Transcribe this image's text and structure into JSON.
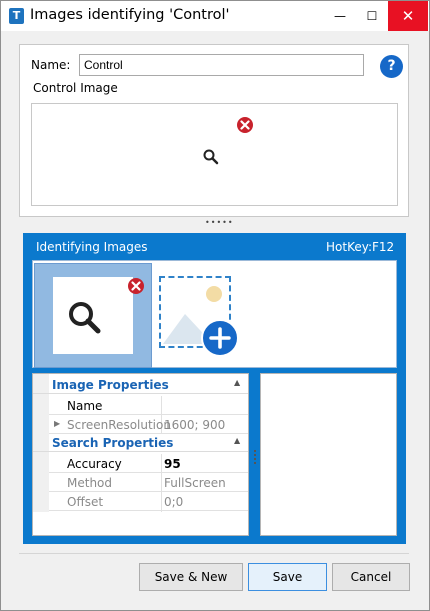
{
  "window": {
    "title": "Images identifying 'Control'",
    "icon_letter": "T",
    "minimize_glyph": "—",
    "maximize_glyph": "☐",
    "close_glyph": "✕"
  },
  "form": {
    "name_label": "Name:",
    "name_value": "Control",
    "help_glyph": "?",
    "control_image_label": "Control Image"
  },
  "identifying": {
    "title": "Identifying Images",
    "hotkey": "HotKey:F12"
  },
  "properties": {
    "categories": [
      {
        "label": "Image Properties",
        "rows": [
          {
            "name": "Name",
            "value": ""
          },
          {
            "name": "ScreenResolution",
            "value": "1600; 900"
          }
        ]
      },
      {
        "label": "Search Properties",
        "rows": [
          {
            "name": "Accuracy",
            "value": "95"
          },
          {
            "name": "Method",
            "value": "FullScreen"
          },
          {
            "name": "Offset",
            "value": "0;0"
          }
        ]
      }
    ]
  },
  "buttons": {
    "save_new": "Save & New",
    "save": "Save",
    "cancel": "Cancel"
  },
  "colors": {
    "accent": "#0b79cd",
    "remove_icon": "#c8222c",
    "category_text": "#1a64b4"
  },
  "icons": [
    "app-icon",
    "minimize-icon",
    "maximize-icon",
    "close-icon",
    "help-icon",
    "search-magnifier-icon",
    "remove-icon",
    "add-image-icon",
    "collapse-arrow-icon",
    "expand-arrow-icon"
  ]
}
